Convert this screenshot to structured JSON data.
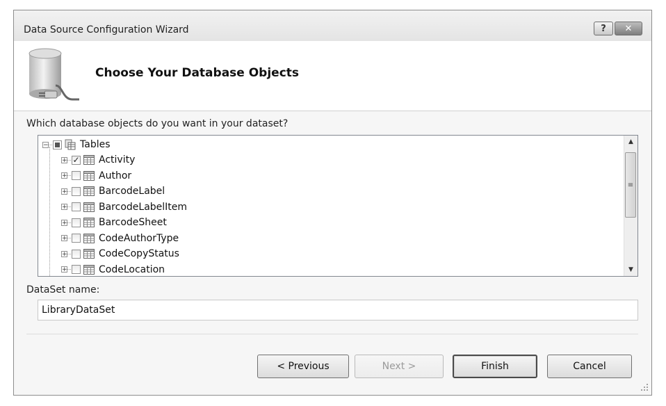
{
  "window": {
    "title": "Data Source Configuration Wizard",
    "help_label": "?",
    "close_label": "✕"
  },
  "header": {
    "title": "Choose Your Database Objects",
    "icon": "database-plug-icon"
  },
  "prompt": "Which database objects do you want in your dataset?",
  "tree": {
    "root": {
      "label": "Tables",
      "expanded": true,
      "state": "partial"
    },
    "items": [
      {
        "label": "Activity",
        "checked": true
      },
      {
        "label": "Author",
        "checked": false
      },
      {
        "label": "BarcodeLabel",
        "checked": false
      },
      {
        "label": "BarcodeLabelItem",
        "checked": false
      },
      {
        "label": "BarcodeSheet",
        "checked": false
      },
      {
        "label": "CodeAuthorType",
        "checked": false
      },
      {
        "label": "CodeCopyStatus",
        "checked": false
      },
      {
        "label": "CodeLocation",
        "checked": false
      }
    ]
  },
  "dataset": {
    "label": "DataSet name:",
    "value": "LibraryDataSet"
  },
  "buttons": {
    "previous": "< Previous",
    "next": "Next >",
    "finish": "Finish",
    "cancel": "Cancel"
  },
  "colors": {
    "dialog_bg": "#f6f6f6",
    "header_bg": "#ffffff",
    "border": "#828790"
  }
}
